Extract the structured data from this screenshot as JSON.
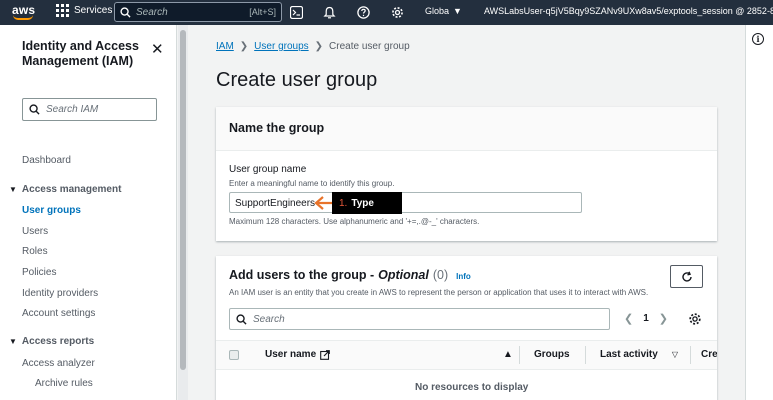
{
  "topnav": {
    "logo": "aws",
    "services": "Services",
    "search_placeholder": "Search",
    "search_shortcut": "[Alt+S]",
    "region": "Globa",
    "account": "AWSLabsUser-q5jV5Bqy9SZANv9UXw8av5/exptools_session @ 2852-8"
  },
  "sidebar": {
    "title": "Identity and Access Management (IAM)",
    "search_placeholder": "Search IAM",
    "dashboard": "Dashboard",
    "section_access_management": "Access management",
    "items": [
      "User groups",
      "Users",
      "Roles",
      "Policies",
      "Identity providers",
      "Account settings"
    ],
    "section_access_reports": "Access reports",
    "reports": [
      "Access analyzer",
      "Archive rules"
    ]
  },
  "breadcrumb": [
    "IAM",
    "User groups",
    "Create user group"
  ],
  "page_title": "Create user group",
  "name_panel": {
    "heading": "Name the group",
    "field_label": "User group name",
    "field_description": "Enter a meaningful name to identify this group.",
    "value": "SupportEngineers",
    "constraint": "Maximum 128 characters. Use alphanumeric and '+=,.@-_' characters."
  },
  "annotation": {
    "number": "1.",
    "label": "Type"
  },
  "users_panel": {
    "heading": "Add users to the group -",
    "optional": "Optional",
    "count": "(0)",
    "info": "Info",
    "description": "An IAM user is an entity that you create in AWS to represent the person or application that uses it to interact with AWS.",
    "search_placeholder": "Search",
    "page": "1",
    "columns": [
      "User name",
      "Groups",
      "Last activity",
      "Crea"
    ],
    "empty_text": "No resources to display"
  },
  "colors": {
    "nav_bg": "#232f3e",
    "link": "#0073bb",
    "annotation_arrow": "#e8732a"
  }
}
